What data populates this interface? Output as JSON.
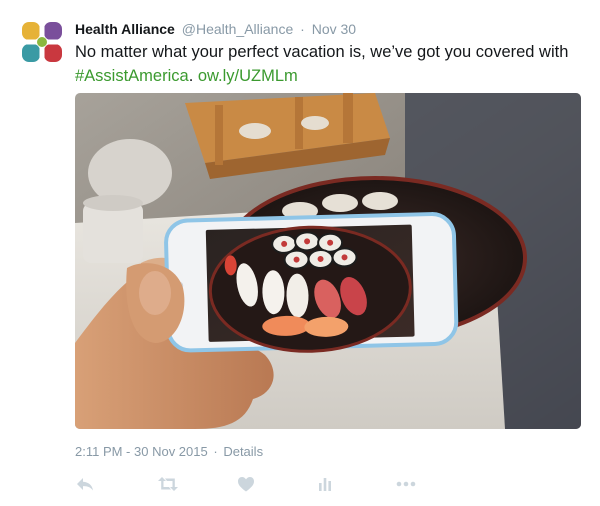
{
  "tweet": {
    "author_name": "Health Alliance",
    "author_handle": "@Health_Alliance",
    "separator": "·",
    "date": "Nov 30",
    "text_before": "No matter what your perfect vacation is, we’ve got you covered with ",
    "hashtag": "#AssistAmerica",
    "text_mid": ". ",
    "link": "ow.ly/UZMLm",
    "timestamp": "2:11 PM - 30 Nov 2015",
    "meta_separator": "·",
    "details_label": "Details"
  },
  "colors": {
    "link": "#3b9a2f",
    "muted": "#8899a6",
    "icon": "#ccd6dd"
  },
  "icons": {
    "avatar": "health-alliance-logo",
    "actions": [
      "reply-icon",
      "retweet-icon",
      "like-icon",
      "analytics-icon",
      "more-icon"
    ]
  }
}
